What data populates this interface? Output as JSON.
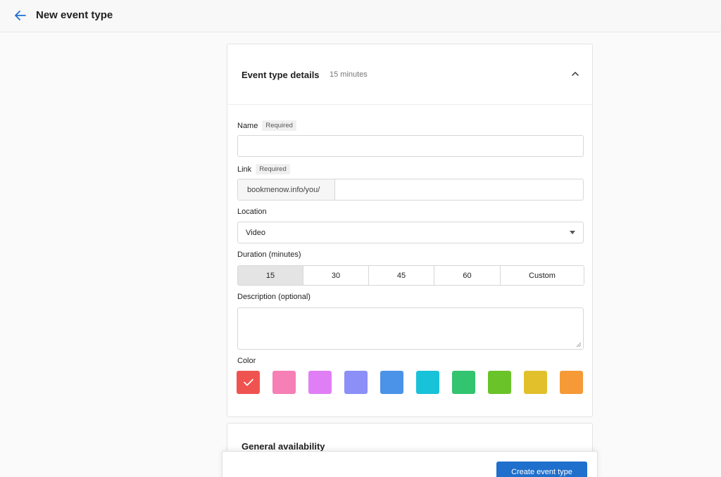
{
  "header": {
    "title": "New event type",
    "back_icon": "arrow-left-icon",
    "accent_color": "#1f6fcc"
  },
  "details": {
    "title": "Event type details",
    "subtitle": "15 minutes",
    "name": {
      "label": "Name",
      "badge": "Required",
      "value": ""
    },
    "link": {
      "label": "Link",
      "badge": "Required",
      "prefix": "bookmenow.info/you/",
      "value": ""
    },
    "location": {
      "label": "Location",
      "value": "Video"
    },
    "duration": {
      "label": "Duration (minutes)",
      "options": [
        "15",
        "30",
        "45",
        "60",
        "Custom"
      ],
      "selected": "15"
    },
    "description": {
      "label": "Description (optional)",
      "value": ""
    },
    "color": {
      "label": "Color",
      "swatches": [
        "#ef5350",
        "#f67fb5",
        "#e07ff5",
        "#8b8ff7",
        "#4a93e8",
        "#18c2d9",
        "#32c46e",
        "#6ac329",
        "#e1c02c",
        "#f59a36"
      ],
      "selected_index": 0
    }
  },
  "availability": {
    "title": "General availability"
  },
  "footer": {
    "create_label": "Create event type"
  }
}
